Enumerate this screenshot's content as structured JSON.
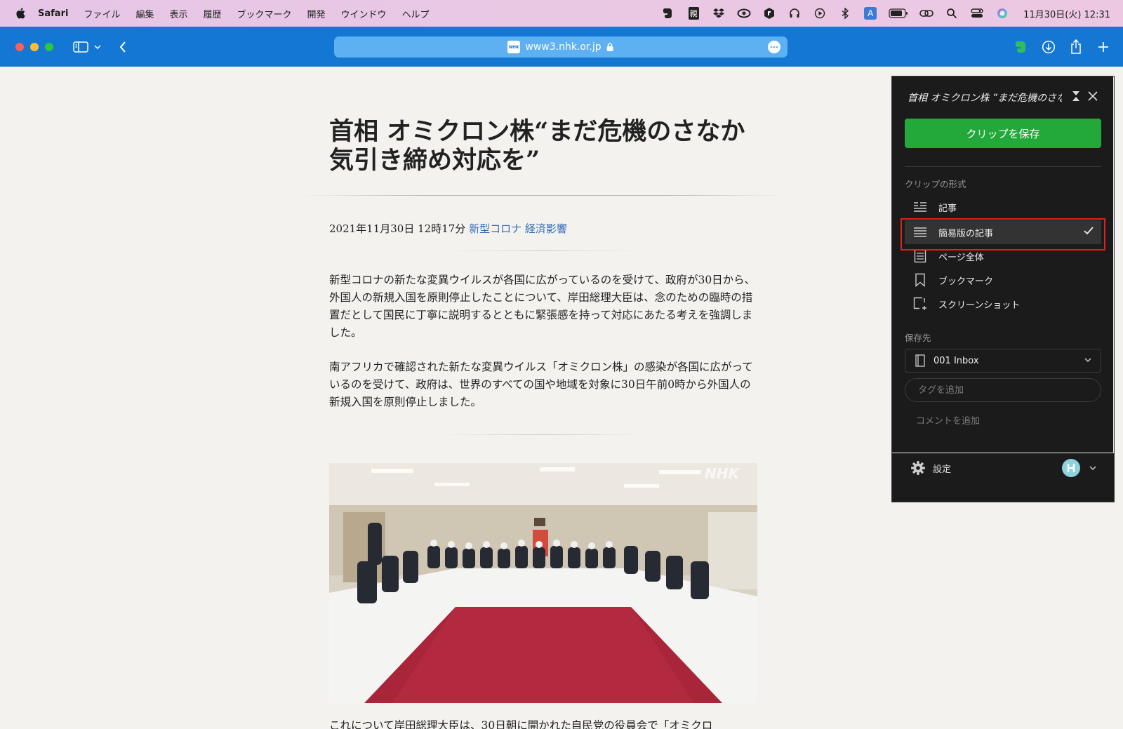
{
  "menubar": {
    "app": "Safari",
    "items": [
      "ファイル",
      "編集",
      "表示",
      "履歴",
      "ブックマーク",
      "開発",
      "ウインドウ",
      "ヘルプ"
    ],
    "ime_label": "A",
    "kanji_label": "親",
    "clock": "11月30日(火) 12:31"
  },
  "browser": {
    "url": "www3.nhk.or.jp",
    "favicon_text": "NHK"
  },
  "article": {
    "title": "首相 オミクロン株“まだ危機のさなか 気引き締め対応を”",
    "date": "2021年11月30日 12時17分",
    "tags": [
      "新型コロナ",
      "経済影響"
    ],
    "paragraphs": [
      "新型コロナの新たな変異ウイルスが各国に広がっているのを受けて、政府が30日から、外国人の新規入国を原則停止したことについて、岸田総理大臣は、念のための臨時の措置だとして国民に丁寧に説明するとともに緊張感を持って対応にあたる考えを強調しました。",
      "南アフリカで確認された新たな変異ウイルス「オミクロン株」の感染が各国に広がっているのを受けて、政府は、世界のすべての国や地域を対象に30日午前0時から外国人の新規入国を原則停止しました。",
      "これについて岸田総理大臣は、30日朝に開かれた自民党の役員会で「オミクロ"
    ],
    "photo_watermark": "NHK"
  },
  "clipper": {
    "title": "首相 オミクロン株 ”まだ危機のさなか 気引き締め対応を”",
    "save_label": "クリップを保存",
    "format_label": "クリップの形式",
    "formats": [
      {
        "label": "記事",
        "selected": false
      },
      {
        "label": "簡易版の記事",
        "selected": true
      },
      {
        "label": "ページ全体",
        "selected": false
      },
      {
        "label": "ブックマーク",
        "selected": false
      },
      {
        "label": "スクリーンショット",
        "selected": false
      }
    ],
    "destination_label": "保存先",
    "notebook": "001 Inbox",
    "tags_placeholder": "タグを追加",
    "comment_placeholder": "コメントを追加",
    "settings_label": "設定",
    "accent_color": "#23a83a",
    "highlight_color": "#e0211a"
  }
}
